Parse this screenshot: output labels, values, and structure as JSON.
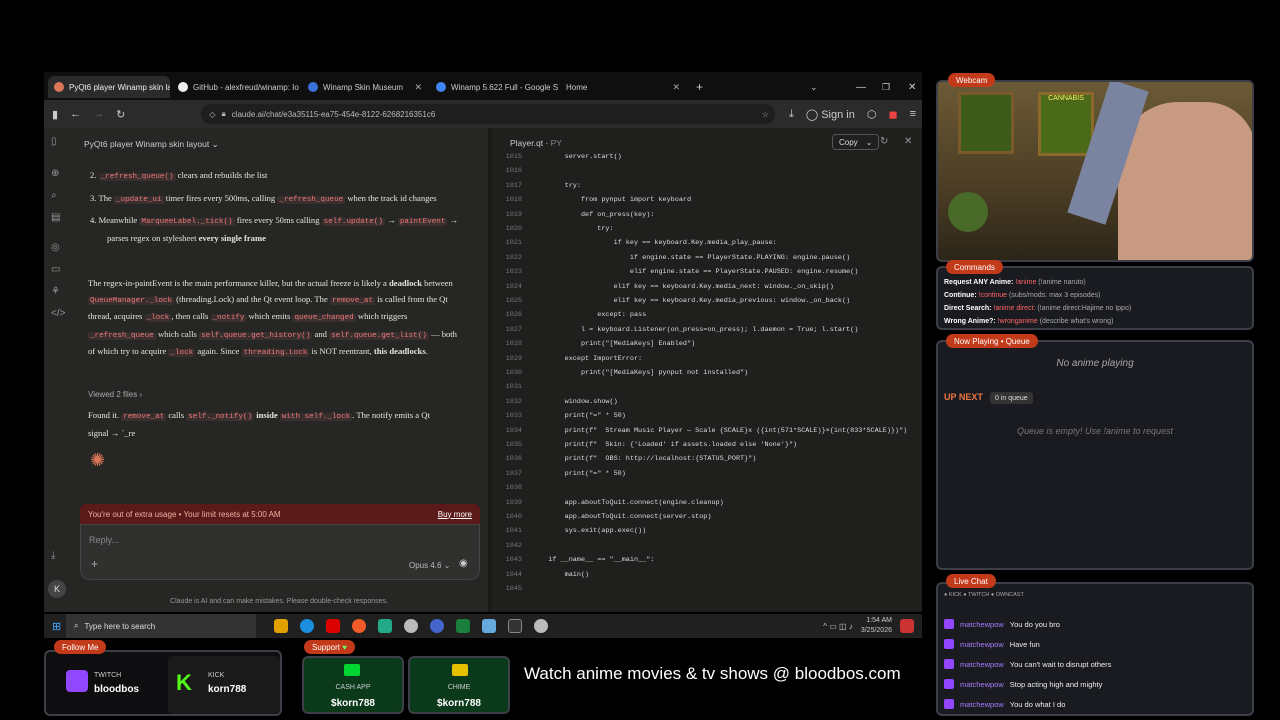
{
  "browser": {
    "tabs": [
      {
        "label": "PyQt6 player Winamp skin layo",
        "active": true
      },
      {
        "label": "GitHub - alexfreud/winamp: Io"
      },
      {
        "label": "Winamp Skin Museum"
      },
      {
        "label": "Winamp 5.622 Full - Google Se"
      },
      {
        "label": "Home"
      }
    ],
    "url": "claude.ai/chat/e3a35115-ea75-454e-8122-6268216351c6",
    "sign_in": "Sign in"
  },
  "chat": {
    "title": "PyQt6 player Winamp skin layout",
    "list": [
      {
        "num": "2.",
        "code": "_refresh_queue()",
        "text": " clears and rebuilds the list"
      },
      {
        "num": "3.",
        "pre": "The ",
        "code": "_update_ui",
        "text": " timer fires every 500ms, calling ",
        "code2": "_refresh_queue",
        "text2": " when the track id changes"
      },
      {
        "num": "4.",
        "pre": "Meanwhile ",
        "code": "MarqueeLabel._tick()",
        "text": " fires every 50ms calling ",
        "code2": "self.update()",
        "text2": " → ",
        "code3": "paintEvent",
        "text3": " → parses regex on stylesheet ",
        "bold": "every single frame"
      }
    ],
    "para_1": "The regex-in-paintEvent is the main performance killer, but the actual freeze is likely a ",
    "para_1_bold": "deadlock",
    "para_1b": " between ",
    "para_1_code": "QueueManager._lock",
    "para_1c": " (threading.Lock) and the Qt event loop. The ",
    "para_1_code2": "remove_at",
    "para_1d": " is called from the Qt thread, acquires ",
    "para_1_code3": "_lock",
    "para_1e": ", then calls ",
    "para_1_code4": "_notify",
    "para_1f": " which emits ",
    "para_1_code5": "queue_changed",
    "para_1g": " which triggers ",
    "para_1_code6": "_refresh_queue",
    "para_1h": " which calls ",
    "para_1_code7": "self.queue.get_history()",
    "para_1i": " and ",
    "para_1_code8": "self.queue.get_list()",
    "para_1j": " — both of which try to acquire ",
    "para_1_code9": "_lock",
    "para_1k": " again. Since ",
    "para_1_code10": "threading.Lock",
    "para_1l": " is NOT reentrant, ",
    "para_1_bold2": "this deadlocks",
    "para_1m": ".",
    "viewed": "Viewed 2 files",
    "found_1": "Found it. ",
    "found_code": "remove_at",
    "found_2": " calls ",
    "found_code2": "self._notify()",
    "found_bold": " inside ",
    "found_code3": "with self._lock",
    "found_3": ". The notify emits a Qt signal → `_re",
    "limit": "You're out of extra usage • Your limit resets at 5:00 AM",
    "buy_more": "Buy more",
    "reply_placeholder": "Reply...",
    "model": "Opus 4.6",
    "disclaimer": "Claude is AI and can make mistakes. Please double-check responses.",
    "avatar_letter": "K"
  },
  "code_panel": {
    "title": "Player.qt",
    "ext": "PY",
    "copy": "Copy",
    "lines": [
      {
        "n": "1015",
        "c": "        server.start()"
      },
      {
        "n": "1016",
        "c": ""
      },
      {
        "n": "1017",
        "c": "        try:"
      },
      {
        "n": "1018",
        "c": "            from pynput import keyboard"
      },
      {
        "n": "1019",
        "c": "            def on_press(key):"
      },
      {
        "n": "1020",
        "c": "                try:"
      },
      {
        "n": "1021",
        "c": "                    if key == keyboard.Key.media_play_pause:"
      },
      {
        "n": "1022",
        "c": "                        if engine.state == PlayerState.PLAYING: engine.pause()"
      },
      {
        "n": "1023",
        "c": "                        elif engine.state == PlayerState.PAUSED: engine.resume()"
      },
      {
        "n": "1024",
        "c": "                    elif key == keyboard.Key.media_next: window._on_skip()"
      },
      {
        "n": "1025",
        "c": "                    elif key == keyboard.Key.media_previous: window._on_back()"
      },
      {
        "n": "1026",
        "c": "                except: pass"
      },
      {
        "n": "1027",
        "c": "            l = keyboard.Listener(on_press=on_press); l.daemon = True; l.start()"
      },
      {
        "n": "1028",
        "c": "            print(\"[MediaKeys] Enabled\")"
      },
      {
        "n": "1029",
        "c": "        except ImportError:"
      },
      {
        "n": "1030",
        "c": "            print(\"[MediaKeys] pynput not installed\")"
      },
      {
        "n": "1031",
        "c": ""
      },
      {
        "n": "1032",
        "c": "        window.show()"
      },
      {
        "n": "1033",
        "c": "        print(\"=\" * 50)"
      },
      {
        "n": "1034",
        "c": "        print(f\"  Stream Music Player — Scale {SCALE}x ({int(571*SCALE)}×{int(833*SCALE)})\")"
      },
      {
        "n": "1035",
        "c": "        print(f\"  Skin: {'Loaded' if assets.loaded else 'None'}\")"
      },
      {
        "n": "1036",
        "c": "        print(f\"  OBS: http://localhost:{STATUS_PORT}\")"
      },
      {
        "n": "1037",
        "c": "        print(\"=\" * 50)"
      },
      {
        "n": "1038",
        "c": ""
      },
      {
        "n": "1039",
        "c": "        app.aboutToQuit.connect(engine.cleanup)"
      },
      {
        "n": "1040",
        "c": "        app.aboutToQuit.connect(server.stop)"
      },
      {
        "n": "1041",
        "c": "        sys.exit(app.exec())"
      },
      {
        "n": "1042",
        "c": ""
      },
      {
        "n": "1043",
        "c": "    if __name__ == \"__main__\":"
      },
      {
        "n": "1044",
        "c": "        main()"
      },
      {
        "n": "1045",
        "c": ""
      }
    ]
  },
  "taskbar": {
    "search_placeholder": "Type here to search",
    "time": "1:54 AM",
    "date": "3/25/2026"
  },
  "overlay": {
    "webcam_tag": "Webcam",
    "commands_tag": "Commands",
    "commands": [
      {
        "label": "Request ANY Anime:",
        "cmd": "!anime",
        "desc": "(!anime naruto)"
      },
      {
        "label": "Continue:",
        "cmd": "!continue",
        "desc": "(subs/mods: max 3 episodes)"
      },
      {
        "label": "Direct Search:",
        "cmd": "!anime direct:",
        "desc": "(!anime direct:Hajime no Ippo)"
      },
      {
        "label": "Wrong Anime?:",
        "cmd": "!wronganime",
        "desc": "(describe what's wrong)"
      }
    ],
    "now_playing_tag": "Now Playing • Queue",
    "no_anime": "No anime playing",
    "up_next": "UP NEXT",
    "in_queue": "0 in queue",
    "queue_empty": "Queue is empty! Use !anime to request",
    "live_chat_tag": "Live Chat",
    "platforms": "● KICK  ● TWITCH  ● OWNCAST",
    "chat": [
      {
        "user": "matchewpow",
        "msg": "You do you bro"
      },
      {
        "user": "matchewpow",
        "msg": "Have fun"
      },
      {
        "user": "matchewpow",
        "msg": "You can't wait to disrupt others"
      },
      {
        "user": "matchewpow",
        "msg": "Stop acting high and mighty"
      },
      {
        "user": "matchewpow",
        "msg": "You do what I do"
      }
    ],
    "follow_tag": "Follow Me",
    "twitch_label": "TWITCH",
    "twitch_user": "bloodbos",
    "kick_label": "KICK",
    "kick_user": "korn788",
    "support_tag": "Support",
    "cashapp_label": "CASH APP",
    "cashapp_user": "$korn788",
    "chime_label": "CHIME",
    "chime_user": "$korn788",
    "banner": "Watch anime movies & tv shows @ bloodbos.com"
  },
  "colors": {
    "accent": "#c23a1a",
    "chat_bg": "#262624",
    "error_bg": "#5a1a1a",
    "twitch": "#9146ff",
    "kick": "#53fc18",
    "cashapp": "#00d632"
  }
}
